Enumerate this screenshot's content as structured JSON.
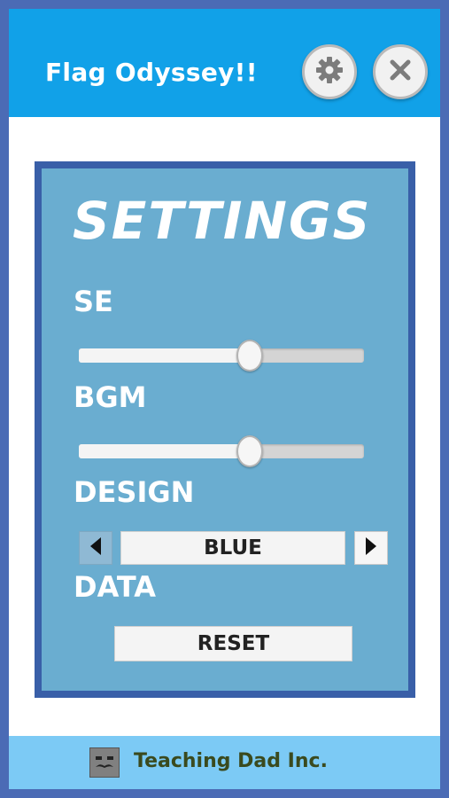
{
  "header": {
    "app_title": "Flag Odyssey!!",
    "settings_icon": "gear-icon",
    "close_icon": "close-icon"
  },
  "settings": {
    "title": "SETTINGS",
    "se": {
      "label": "SE",
      "value": 0.6
    },
    "bgm": {
      "label": "BGM",
      "value": 0.6
    },
    "design": {
      "label": "DESIGN",
      "value": "BLUE",
      "prev_icon": "triangle-left-icon",
      "next_icon": "triangle-right-icon"
    },
    "data": {
      "label": "DATA",
      "reset_label": "RESET"
    }
  },
  "footer": {
    "company": "Teaching Dad Inc.",
    "logo_icon": "mustache-face-icon"
  },
  "colors": {
    "header": "#11a1e8",
    "panel": "#6aadd0",
    "panel_border": "#395fa8",
    "footer": "#7ccaf5",
    "frame": "#4b6bb5"
  }
}
